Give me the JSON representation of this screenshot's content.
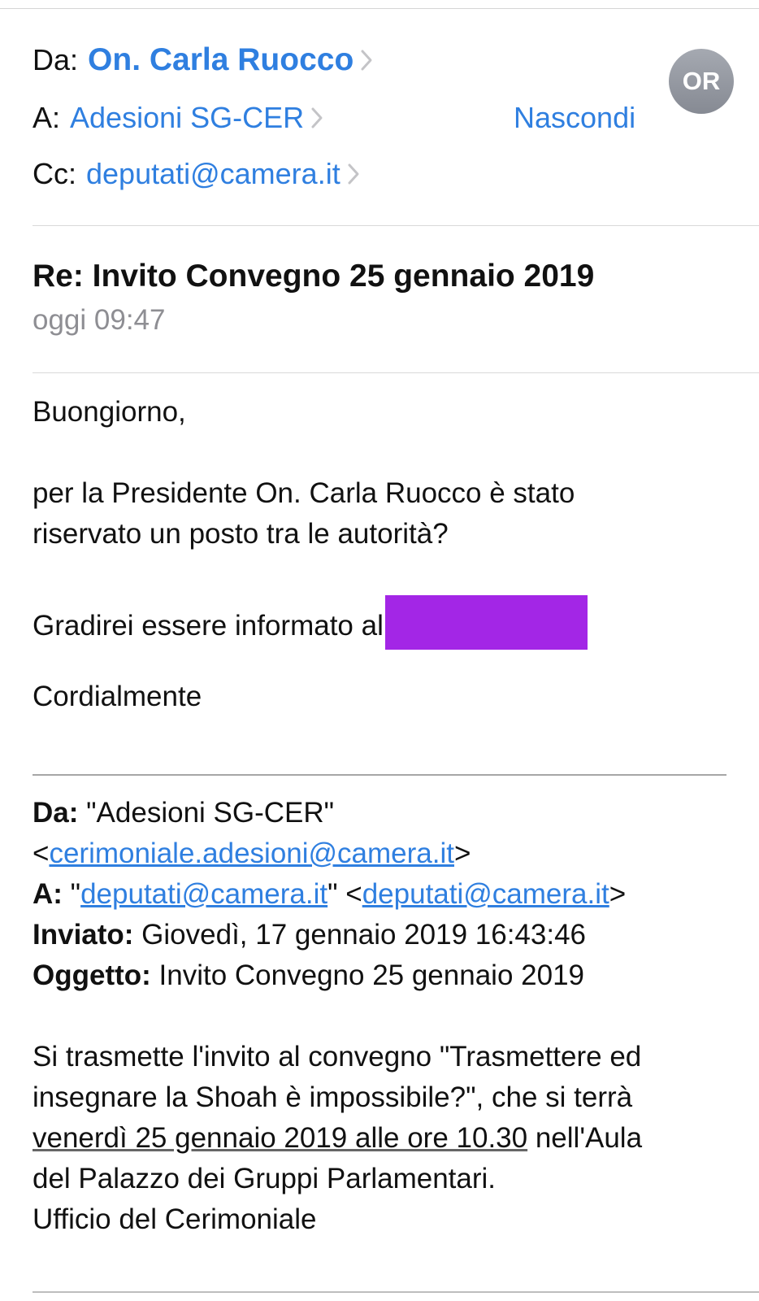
{
  "header": {
    "from_key": "Da:",
    "from_name": "On. Carla Ruocco",
    "to_key": "A:",
    "to_name": "Adesioni SG-CER",
    "cc_key": "Cc:",
    "cc_address": "deputati@camera.it",
    "hide_label": "Nascondi",
    "avatar_initials": "OR"
  },
  "message": {
    "subject": "Re: Invito Convegno 25 gennaio 2019",
    "date": "oggi 09:47",
    "greeting": "Buongiorno,",
    "paragraph1_line1": "per la Presidente On. Carla Ruocco è stato",
    "paragraph1_line2": "riservato un posto tra le autorità?",
    "paragraph2": "Gradirei essere informato al",
    "closing": "Cordialmente"
  },
  "quoted": {
    "from_key": "Da:",
    "from_name": " \"Adesioni SG-CER\"",
    "from_email_open": "<",
    "from_email": "cerimoniale.adesioni@camera.it",
    "from_email_close": ">",
    "to_key": "A:",
    "to_quote_open": " \"",
    "to_name_link": "deputati@camera.it",
    "to_quote_close": "\" <",
    "to_email": "deputati@camera.it",
    "to_email_close": ">",
    "sent_key": "Inviato:",
    "sent_value": " Giovedì, 17 gennaio 2019 16:43:46",
    "subject_key": "Oggetto:",
    "subject_value": " Invito Convegno 25 gennaio 2019",
    "body_line1": "Si trasmette l'invito al convegno \"Trasmettere ed",
    "body_line2": "insegnare la Shoah è impossibile?\", che si terrà",
    "body_line3_underlined": "venerdì 25 gennaio 2019 alle ore 10.30",
    "body_line3_rest": " nell'Aula",
    "body_line4": "del Palazzo dei Gruppi Parlamentari.",
    "body_line5": "Ufficio del Cerimoniale"
  },
  "colors": {
    "link": "#2f7fe0",
    "redaction": "#a326e6",
    "avatar": "#9a9ea6",
    "secondary_text": "#8e8e93"
  },
  "icons": {
    "chevron": "chevron-right-icon",
    "avatar": "avatar"
  }
}
